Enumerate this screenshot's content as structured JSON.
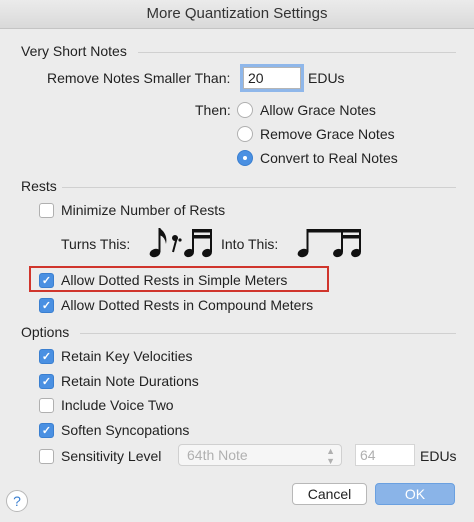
{
  "window": {
    "title": "More Quantization Settings"
  },
  "very_short_notes": {
    "heading": "Very Short Notes",
    "remove_label": "Remove Notes Smaller Than:",
    "remove_value": "20",
    "unit": "EDUs",
    "then_label": "Then:",
    "options": [
      {
        "label": "Allow Grace Notes",
        "selected": false
      },
      {
        "label": "Remove Grace Notes",
        "selected": false
      },
      {
        "label": "Convert to Real Notes",
        "selected": true
      }
    ]
  },
  "rests": {
    "heading": "Rests",
    "minimize": {
      "label": "Minimize Number of Rests",
      "checked": false
    },
    "turns_this": "Turns This:",
    "into_this": "Into This:",
    "allow_dotted_simple": {
      "label": "Allow Dotted Rests in Simple Meters",
      "checked": true
    },
    "allow_dotted_compound": {
      "label": "Allow Dotted Rests in Compound Meters",
      "checked": true
    }
  },
  "options": {
    "heading": "Options",
    "items": [
      {
        "label": "Retain Key Velocities",
        "checked": true
      },
      {
        "label": "Retain Note Durations",
        "checked": true
      },
      {
        "label": "Include Voice Two",
        "checked": false
      },
      {
        "label": "Soften Syncopations",
        "checked": true
      }
    ],
    "sensitivity": {
      "label": "Sensitivity Level",
      "checked": false,
      "select_value": "64th Note",
      "value_placeholder": "64",
      "unit": "EDUs"
    }
  },
  "buttons": {
    "cancel": "Cancel",
    "ok": "OK",
    "help": "?"
  },
  "colors": {
    "accent": "#4a90e2",
    "highlight": "#d0352c"
  }
}
